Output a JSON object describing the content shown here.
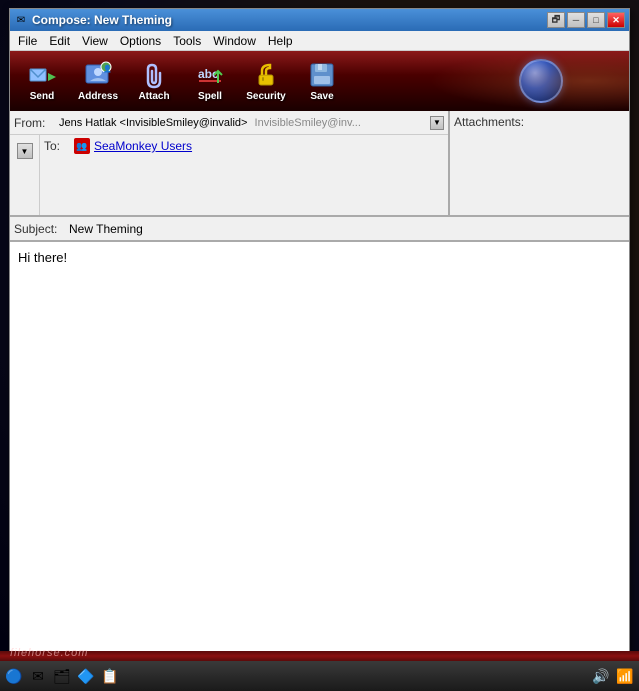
{
  "window": {
    "title": "Compose: New Theming",
    "title_icon": "✉"
  },
  "title_buttons": {
    "restore": "🗗",
    "minimize": "─",
    "maximize": "□",
    "close": "✕"
  },
  "menu": {
    "items": [
      "File",
      "Edit",
      "View",
      "Options",
      "Tools",
      "Window",
      "Help"
    ]
  },
  "toolbar": {
    "buttons": [
      {
        "id": "send",
        "label": "Send",
        "icon_type": "send"
      },
      {
        "id": "address",
        "label": "Address",
        "icon_type": "address"
      },
      {
        "id": "attach",
        "label": "Attach",
        "icon_type": "attach"
      },
      {
        "id": "spell",
        "label": "Spell",
        "icon_type": "spell"
      },
      {
        "id": "security",
        "label": "Security",
        "icon_type": "security"
      },
      {
        "id": "save",
        "label": "Save",
        "icon_type": "save"
      }
    ]
  },
  "compose": {
    "from_label": "From:",
    "from_name": "Jens Hatlak <InvisibleSmiley@invalid>",
    "from_secondary": "InvisibleSmiley@inv...",
    "to_label": "To:",
    "recipient_name": "SeaMonkey Users",
    "subject_label": "Subject:",
    "subject_value": "New Theming",
    "attachments_label": "Attachments:",
    "body": "Hi there!"
  }
}
